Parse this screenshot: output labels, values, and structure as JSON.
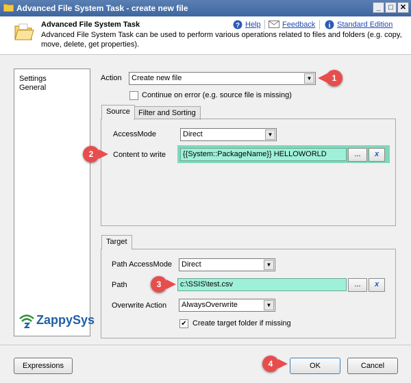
{
  "window": {
    "title": "Advanced File System Task - create new file",
    "minimize": "_",
    "maximize": "□",
    "close": "✕"
  },
  "header": {
    "title": "Advanced File System Task",
    "description": "Advanced File System Task can be used to perform various operations related to files and folders (e.g. copy, move, delete, get properties).",
    "help": "Help",
    "feedback": "Feedback",
    "edition": "Standard Edition"
  },
  "nav": {
    "items": [
      "Settings",
      "General"
    ]
  },
  "action": {
    "label": "Action",
    "value": "Create new file",
    "continue_on_error": "Continue on error (e.g. source file is missing)",
    "continue_checked": false
  },
  "source": {
    "tabs": [
      "Source",
      "Filter and Sorting"
    ],
    "access_mode_label": "AccessMode",
    "access_mode_value": "Direct",
    "content_label": "Content to write",
    "content_value": "{{System::PackageName}} HELLOWORLD",
    "browse": "...",
    "clear": "x"
  },
  "target": {
    "tab": "Target",
    "path_access_mode_label": "Path AccessMode",
    "path_access_mode_value": "Direct",
    "path_label": "Path",
    "path_value": "c:\\SSIS\\test.csv",
    "browse": "...",
    "clear": "x",
    "overwrite_label": "Overwrite Action",
    "overwrite_value": "AlwaysOverwrite",
    "create_folder": "Create target folder if missing",
    "create_folder_checked": true
  },
  "logo": {
    "text": "ZappySys"
  },
  "buttons": {
    "expressions": "Expressions",
    "ok": "OK",
    "cancel": "Cancel"
  },
  "callouts": [
    "1",
    "2",
    "3",
    "4"
  ],
  "colors": {
    "callout": "#e84d4d",
    "highlight": "#9ff0d8",
    "link": "#2049b0",
    "logo_green": "#2f8f3a"
  }
}
